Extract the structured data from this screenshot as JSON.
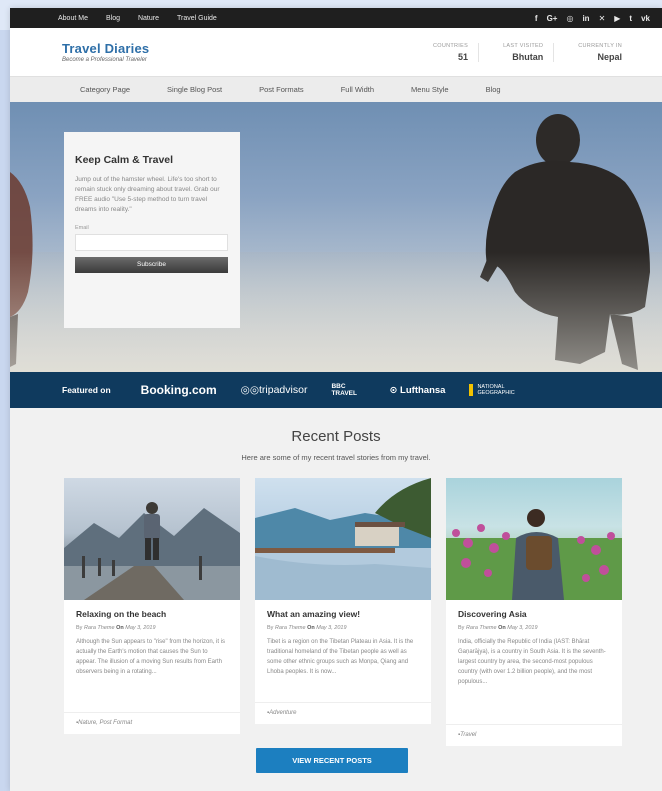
{
  "topbar": {
    "links": [
      "About Me",
      "Blog",
      "Nature",
      "Travel Guide"
    ],
    "social_icons": [
      "facebook-icon",
      "google-plus-icon",
      "instagram-icon",
      "linkedin-icon",
      "twitter-icon",
      "youtube-icon",
      "tumblr-icon",
      "vk-icon"
    ],
    "social_glyphs": [
      "f",
      "G+",
      "◎",
      "in",
      "✕",
      "▶",
      "t",
      "vk"
    ]
  },
  "header": {
    "site_title": "Travel Diaries",
    "tagline": "Become a Professional Traveler",
    "stats": [
      {
        "label": "COUNTRIES",
        "value": "51"
      },
      {
        "label": "LAST VISITED",
        "value": "Bhutan"
      },
      {
        "label": "CURRENTLY IN",
        "value": "Nepal"
      }
    ]
  },
  "nav": {
    "items": [
      "Category Page",
      "Single Blog Post",
      "Post Formats",
      "Full Width",
      "Menu Style",
      "Blog"
    ]
  },
  "hero": {
    "subscribe": {
      "heading": "Keep Calm & Travel",
      "text": "Jump out of the hamster wheel. Life's too short to remain stuck only dreaming about travel. Grab our FREE audio \"Use 5-step method to turn travel dreams into reality.\"",
      "email_label": "Email",
      "email_value": "",
      "button": "Subscribe"
    }
  },
  "featured": {
    "label": "Featured on",
    "logos": [
      "Booking.com",
      "tripadvisor",
      "BBC TRAVEL",
      "Lufthansa",
      "NATIONAL GEOGRAPHIC"
    ]
  },
  "recent": {
    "title": "Recent Posts",
    "subtitle": "Here are some of my recent travel stories from my travel.",
    "posts": [
      {
        "title": "Relaxing on the beach",
        "by": "By",
        "author": "Rara Theme",
        "on": "On",
        "date": "May 3, 2019",
        "excerpt": "Although the Sun appears to \"rise\" from the horizon, it is actually the Earth's motion that causes the Sun to appear. The illusion of a moving Sun results from Earth observers being in a rotating...",
        "categories": "Nature, Post Format"
      },
      {
        "title": "What an amazing view!",
        "by": "By",
        "author": "Rara Theme",
        "on": "On",
        "date": "May 3, 2019",
        "excerpt": "Tibet is a region on the Tibetan Plateau in Asia. It is the traditional homeland of the Tibetan people as well as some other ethnic groups such as Monpa, Qiang and Lhoba peoples. It is now...",
        "categories": "Adventure"
      },
      {
        "title": "Discovering Asia",
        "by": "By",
        "author": "Rara Theme",
        "on": "On",
        "date": "May 3, 2019",
        "excerpt": "India, officially the Republic of India (IAST: Bhārat Gaṇarājya), is a country in South Asia. It is the seventh-largest country by area, the second-most populous country (with over 1.2 billion people), and the most populous...",
        "categories": "Travel"
      }
    ],
    "button": "VIEW RECENT POSTS"
  }
}
